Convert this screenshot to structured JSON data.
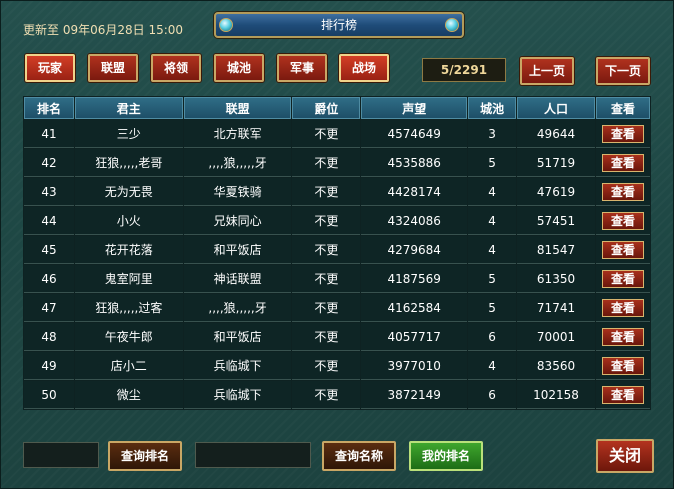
{
  "update_label": "更新至 09年06月28日 15:00",
  "title": "排行榜",
  "tabs": [
    {
      "label": "玩家",
      "active": true
    },
    {
      "label": "联盟",
      "active": false
    },
    {
      "label": "将领",
      "active": false
    },
    {
      "label": "城池",
      "active": false
    },
    {
      "label": "军事",
      "active": false
    },
    {
      "label": "战场",
      "active": true
    }
  ],
  "pagination": {
    "info": "5/2291",
    "prev": "上一页",
    "next": "下一页"
  },
  "table": {
    "headers": [
      "排名",
      "君主",
      "联盟",
      "爵位",
      "声望",
      "城池",
      "人口",
      "查看"
    ],
    "view_label": "查看",
    "rows": [
      {
        "rank": "41",
        "lord": "三少",
        "alliance": "北方联军",
        "title": "不更",
        "prestige": "4574649",
        "cities": "3",
        "population": "49644"
      },
      {
        "rank": "42",
        "lord": "狂狼,,,,,老哥",
        "alliance": ",,,,狼,,,,,牙",
        "title": "不更",
        "prestige": "4535886",
        "cities": "5",
        "population": "51719"
      },
      {
        "rank": "43",
        "lord": "无为无畏",
        "alliance": "华夏铁骑",
        "title": "不更",
        "prestige": "4428174",
        "cities": "4",
        "population": "47619"
      },
      {
        "rank": "44",
        "lord": "小火",
        "alliance": "兄妹同心",
        "title": "不更",
        "prestige": "4324086",
        "cities": "4",
        "population": "57451"
      },
      {
        "rank": "45",
        "lord": "花开花落",
        "alliance": "和平饭店",
        "title": "不更",
        "prestige": "4279684",
        "cities": "4",
        "population": "81547"
      },
      {
        "rank": "46",
        "lord": "鬼室阿里",
        "alliance": "神话联盟",
        "title": "不更",
        "prestige": "4187569",
        "cities": "5",
        "population": "61350"
      },
      {
        "rank": "47",
        "lord": "狂狼,,,,,过客",
        "alliance": ",,,,狼,,,,,牙",
        "title": "不更",
        "prestige": "4162584",
        "cities": "5",
        "population": "71741"
      },
      {
        "rank": "48",
        "lord": "午夜牛郎",
        "alliance": "和平饭店",
        "title": "不更",
        "prestige": "4057717",
        "cities": "6",
        "population": "70001"
      },
      {
        "rank": "49",
        "lord": "店小二",
        "alliance": "兵临城下",
        "title": "不更",
        "prestige": "3977010",
        "cities": "4",
        "population": "83560"
      },
      {
        "rank": "50",
        "lord": "微尘",
        "alliance": "兵临城下",
        "title": "不更",
        "prestige": "3872149",
        "cities": "6",
        "population": "102158"
      }
    ]
  },
  "search": {
    "rank_input_value": "",
    "rank_button": "查询排名",
    "name_input_value": "",
    "name_button": "查询名称",
    "my_rank_button": "我的排名"
  },
  "close_label": "关闭"
}
